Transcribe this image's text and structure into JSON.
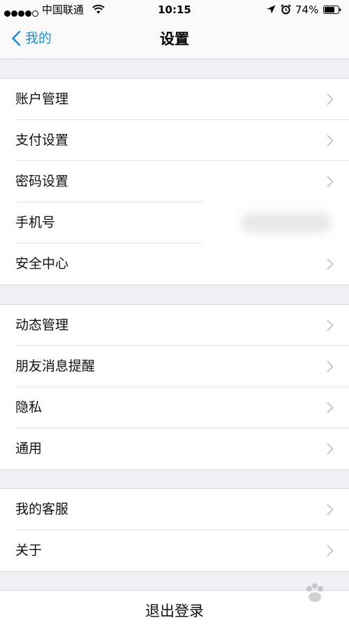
{
  "status_bar": {
    "carrier": "中国联通",
    "time": "10:15",
    "battery": "74%",
    "signal_bars_filled": 4,
    "signal_bars_total": 5,
    "battery_level": 0.74
  },
  "nav": {
    "back_label": "我的",
    "title": "设置"
  },
  "groups": [
    {
      "items": [
        {
          "label": "账户管理"
        },
        {
          "label": "支付设置"
        },
        {
          "label": "密码设置"
        },
        {
          "label": "手机号"
        },
        {
          "label": "安全中心"
        }
      ]
    },
    {
      "items": [
        {
          "label": "动态管理"
        },
        {
          "label": "朋友消息提醒"
        },
        {
          "label": "隐私"
        },
        {
          "label": "通用"
        }
      ]
    },
    {
      "items": [
        {
          "label": "我的客服"
        },
        {
          "label": "关于"
        }
      ]
    }
  ],
  "logout_label": "退出登录",
  "colors": {
    "accent": "#1f8ecf",
    "background": "#efeff4",
    "chevron": "#c7c7cc"
  },
  "icons": {
    "back": "chevron-left-icon",
    "disclosure": "chevron-right-icon",
    "wifi": "wifi-icon",
    "location": "location-arrow-icon",
    "alarm": "alarm-clock-icon",
    "battery": "battery-icon"
  }
}
